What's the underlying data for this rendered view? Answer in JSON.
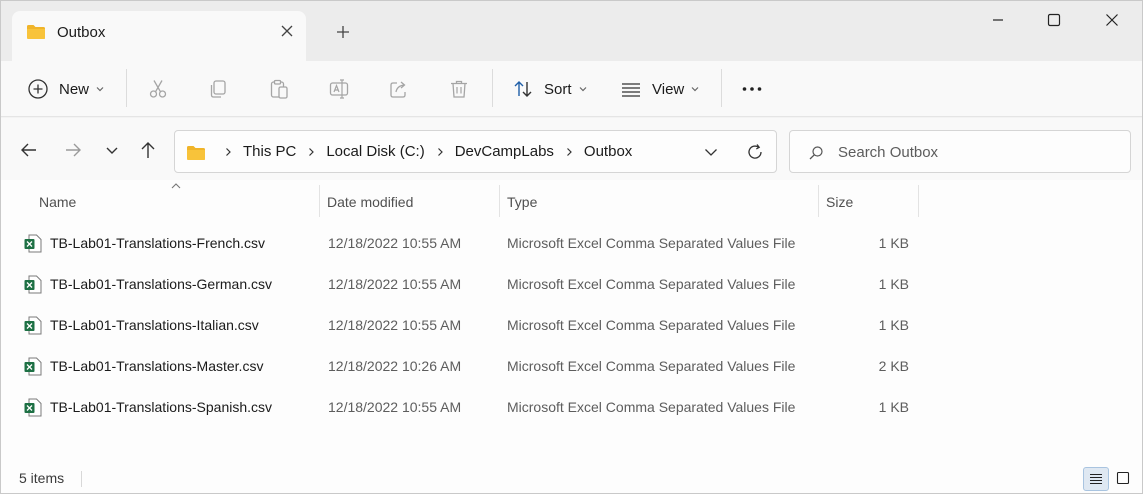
{
  "window": {
    "tab_title": "Outbox",
    "controls": {
      "minimize": "minimize",
      "maximize": "maximize",
      "close": "close"
    }
  },
  "toolbar": {
    "new_label": "New",
    "sort_label": "Sort",
    "view_label": "View",
    "icons": [
      "cut-icon",
      "copy-icon",
      "paste-icon",
      "rename-icon",
      "share-icon",
      "delete-icon",
      "more-icon"
    ]
  },
  "address": {
    "crumbs": [
      "This PC",
      "Local Disk (C:)",
      "DevCampLabs",
      "Outbox"
    ]
  },
  "search": {
    "placeholder": "Search Outbox"
  },
  "columns": {
    "name": "Name",
    "date": "Date modified",
    "type": "Type",
    "size": "Size"
  },
  "files": [
    {
      "name": "TB-Lab01-Translations-French.csv",
      "date": "12/18/2022 10:55 AM",
      "type": "Microsoft Excel Comma Separated Values File",
      "size": "1 KB"
    },
    {
      "name": "TB-Lab01-Translations-German.csv",
      "date": "12/18/2022 10:55 AM",
      "type": "Microsoft Excel Comma Separated Values File",
      "size": "1 KB"
    },
    {
      "name": "TB-Lab01-Translations-Italian.csv",
      "date": "12/18/2022 10:55 AM",
      "type": "Microsoft Excel Comma Separated Values File",
      "size": "1 KB"
    },
    {
      "name": "TB-Lab01-Translations-Master.csv",
      "date": "12/18/2022 10:26 AM",
      "type": "Microsoft Excel Comma Separated Values File",
      "size": "2 KB"
    },
    {
      "name": "TB-Lab01-Translations-Spanish.csv",
      "date": "12/18/2022 10:55 AM",
      "type": "Microsoft Excel Comma Separated Values File",
      "size": "1 KB"
    }
  ],
  "status": {
    "item_count": "5 items"
  },
  "colors": {
    "folder": "#f8c33a",
    "excel": "#1d7044",
    "accent": "#0067c0"
  }
}
